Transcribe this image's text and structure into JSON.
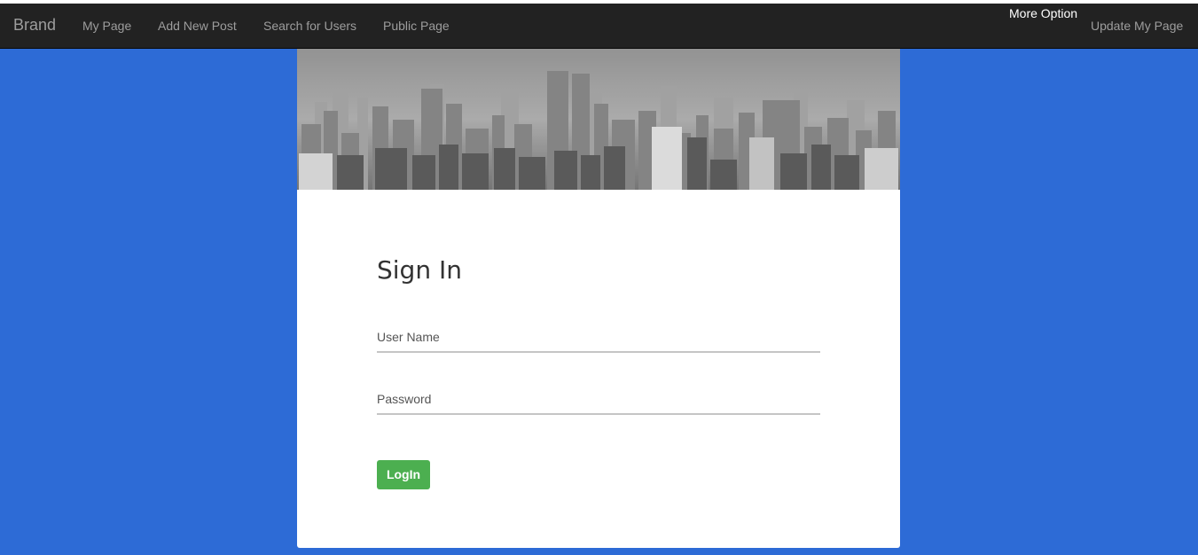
{
  "navbar": {
    "brand": "Brand",
    "links": [
      "My Page",
      "Add New Post",
      "Search for Users",
      "Public Page"
    ],
    "more_option": "More Option",
    "update_my_page": "Update My Page"
  },
  "signin": {
    "title": "Sign In",
    "username_label": "User Name",
    "password_label": "Password",
    "login_label": "LogIn"
  },
  "colors": {
    "page_background": "#2d6bd6",
    "navbar": "#222222",
    "login_button": "#4caf50"
  }
}
